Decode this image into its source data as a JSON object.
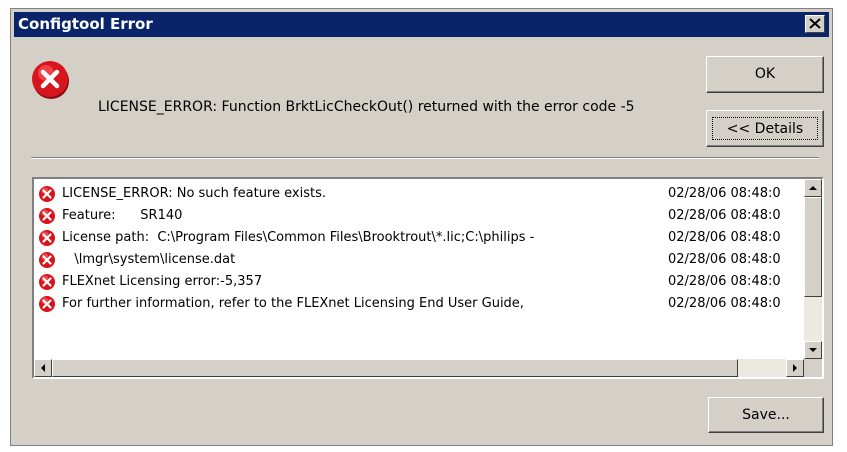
{
  "window": {
    "title": "Configtool Error"
  },
  "message": "LICENSE_ERROR: Function BrktLicCheckOut() returned with the error code -5",
  "buttons": {
    "ok": "OK",
    "details": "<< Details",
    "save": "Save..."
  },
  "log": [
    {
      "text": "LICENSE_ERROR: No such feature exists.",
      "time": "02/28/06 08:48:0",
      "icon": "error-icon"
    },
    {
      "text": "Feature:      SR140",
      "time": "02/28/06 08:48:0",
      "icon": "error-icon"
    },
    {
      "text": "License path:  C:\\Program Files\\Common Files\\Brooktrout\\*.lic;C:\\philips -",
      "time": "02/28/06 08:48:0",
      "icon": "error-icon"
    },
    {
      "text": "   \\lmgr\\system\\license.dat",
      "time": "02/28/06 08:48:0",
      "icon": "error-icon"
    },
    {
      "text": "FLEXnet Licensing error:-5,357",
      "time": "02/28/06 08:48:0",
      "icon": "error-icon"
    },
    {
      "text": "For further information, refer to the FLEXnet Licensing End User Guide,",
      "time": "02/28/06 08:48:0",
      "icon": "error-icon"
    }
  ],
  "colors": {
    "titlebar": "#0a246a",
    "dialog": "#d4d0c8",
    "error_red": "#d8141c"
  }
}
